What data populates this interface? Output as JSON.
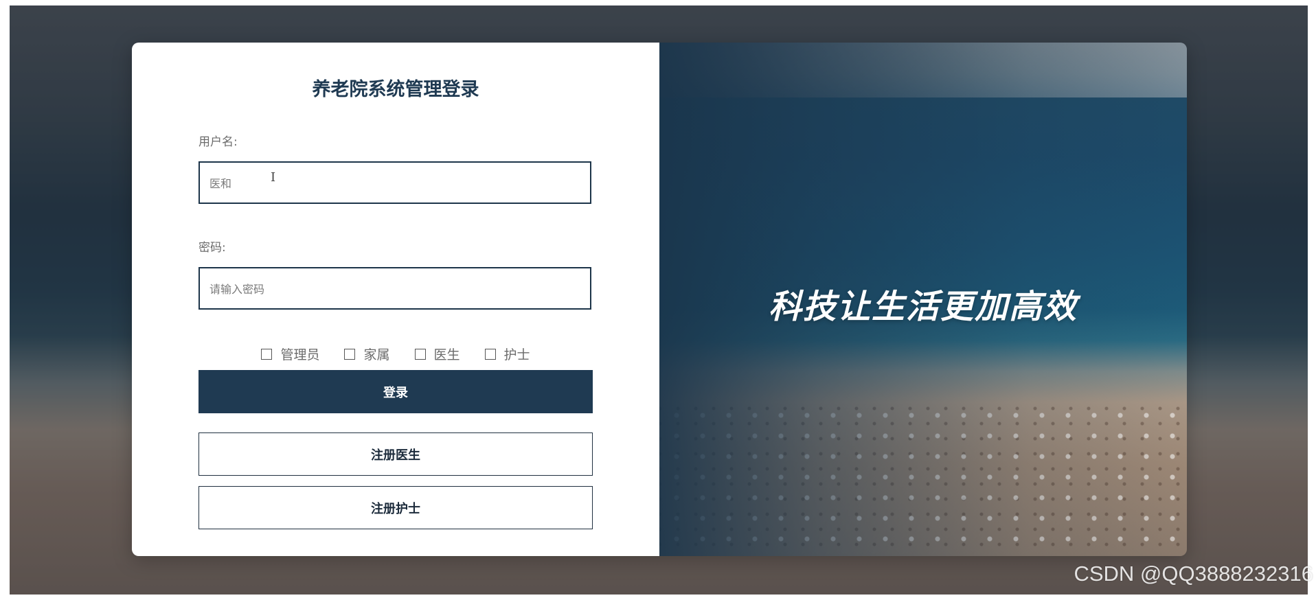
{
  "login": {
    "title": "养老院系统管理登录",
    "username_label": "用户名:",
    "username_value": "医和",
    "password_label": "密码:",
    "password_placeholder": "请输入密码",
    "roles": [
      "管理员",
      "家属",
      "医生",
      "护士"
    ],
    "login_button": "登录",
    "register_doctor_button": "注册医生",
    "register_nurse_button": "注册护士"
  },
  "banner": {
    "slogan": "科技让生活更加高效"
  },
  "watermark": "CSDN @QQ3888232316",
  "colors": {
    "primary": "#1f3a52",
    "card_bg": "#ffffff"
  }
}
